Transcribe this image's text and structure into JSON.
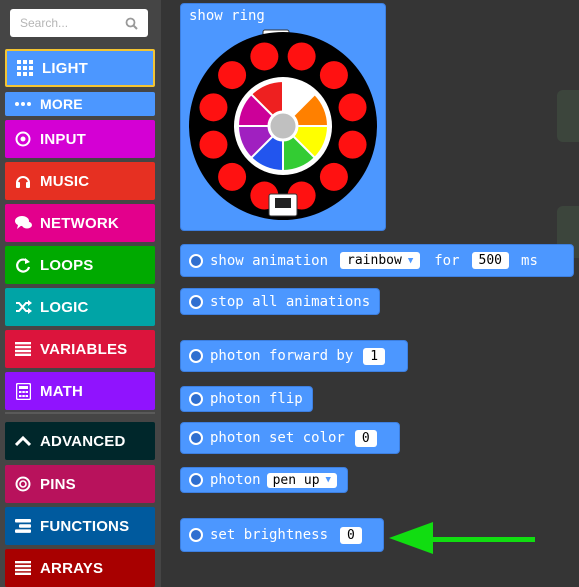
{
  "search": {
    "placeholder": "Search..."
  },
  "categories": [
    {
      "label": "LIGHT",
      "icon": "grid-icon",
      "color": "#4c97ff"
    },
    {
      "label": "MORE",
      "icon": "ellipsis-icon",
      "color": "#4c97ff"
    },
    {
      "label": "INPUT",
      "icon": "target-icon",
      "color": "#d400d4"
    },
    {
      "label": "MUSIC",
      "icon": "headphones-icon",
      "color": "#e63022"
    },
    {
      "label": "NETWORK",
      "icon": "chat-icon",
      "color": "#e3008c"
    },
    {
      "label": "LOOPS",
      "icon": "refresh-icon",
      "color": "#00aa00"
    },
    {
      "label": "LOGIC",
      "icon": "shuffle-icon",
      "color": "#00a4a6"
    },
    {
      "label": "VARIABLES",
      "icon": "list-icon",
      "color": "#dc143c"
    },
    {
      "label": "MATH",
      "icon": "calculator-icon",
      "color": "#9013fe"
    },
    {
      "label": "ADVANCED",
      "icon": "chevron-up-icon",
      "color": "#00272b"
    },
    {
      "label": "PINS",
      "icon": "circle-icon",
      "color": "#b8125c"
    },
    {
      "label": "FUNCTIONS",
      "icon": "functions-icon",
      "color": "#005a9e"
    },
    {
      "label": "ARRAYS",
      "icon": "array-icon",
      "color": "#a80000"
    }
  ],
  "blocks": {
    "show_ring": {
      "label": "show ring"
    },
    "show_animation": {
      "label": "show animation",
      "value": "rainbow",
      "for": "for",
      "ms_value": "500",
      "unit": "ms"
    },
    "stop_animations": {
      "label": "stop all animations"
    },
    "photon_forward": {
      "label": "photon forward by",
      "value": "1"
    },
    "photon_flip": {
      "label": "photon flip"
    },
    "photon_set_color": {
      "label": "photon set color",
      "value": "0"
    },
    "photon_pen": {
      "label": "photon",
      "value": "pen up"
    },
    "set_brightness": {
      "label": "set brightness",
      "value": "0"
    }
  },
  "ring_colors": [
    "#ffffff",
    "#ff8000",
    "#ffff00",
    "#33cc33",
    "#2255ee",
    "#a020c0",
    "#cc0099",
    "#ee2020"
  ],
  "accent": "#4c97ff",
  "arrow_color": "#11dd11"
}
